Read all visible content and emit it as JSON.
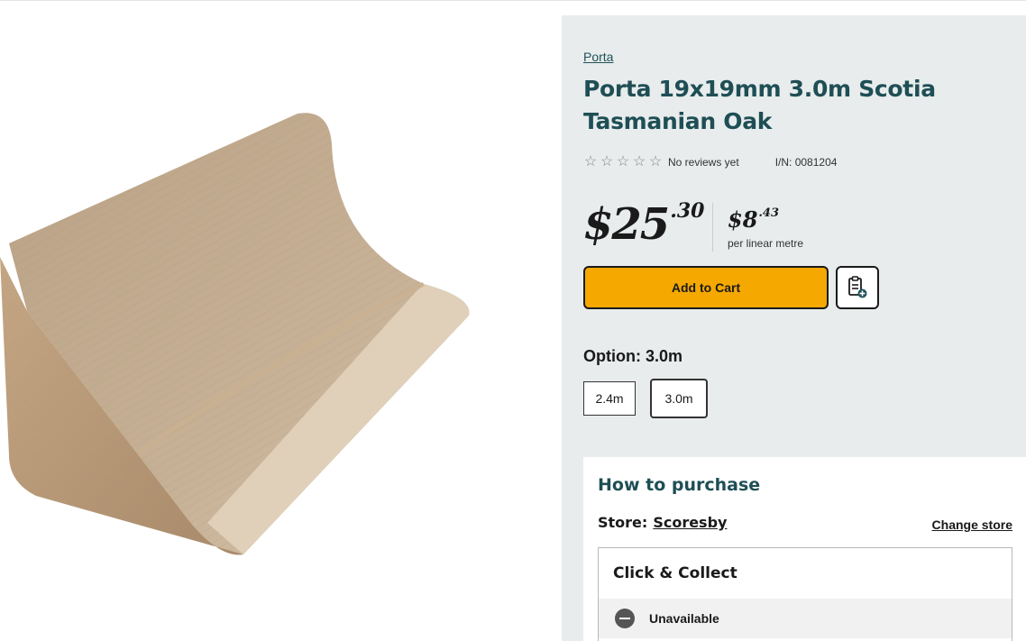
{
  "product": {
    "brand": "Porta",
    "title": "Porta 19x19mm 3.0m Scotia Tasmanian Oak",
    "rating": {
      "stars": 0,
      "max_stars": 5,
      "reviews_text": "No reviews yet"
    },
    "item_number": "I/N: 0081204",
    "price": {
      "dollars": "$25",
      "cents": ".30"
    },
    "unit_price": {
      "dollars": "$8",
      "cents": ".43",
      "label": "per linear metre"
    },
    "add_to_cart_label": "Add to Cart",
    "icons": {
      "list": "add-to-list-icon",
      "star": "star-outline-icon",
      "status": "unavailable-icon"
    },
    "options": {
      "label": "Option: 3.0m",
      "items": [
        {
          "label": "2.4m",
          "selected": false
        },
        {
          "label": "3.0m",
          "selected": true
        }
      ]
    }
  },
  "purchase": {
    "title": "How to purchase",
    "store_label": "Store:",
    "store_name": "Scoresby",
    "change_store_label": "Change store",
    "click_collect": {
      "title": "Click & Collect",
      "status": "Unavailable"
    }
  },
  "colors": {
    "panel_bg": "#e8ecec",
    "title": "#1f4e55",
    "cta": "#f5a800"
  }
}
